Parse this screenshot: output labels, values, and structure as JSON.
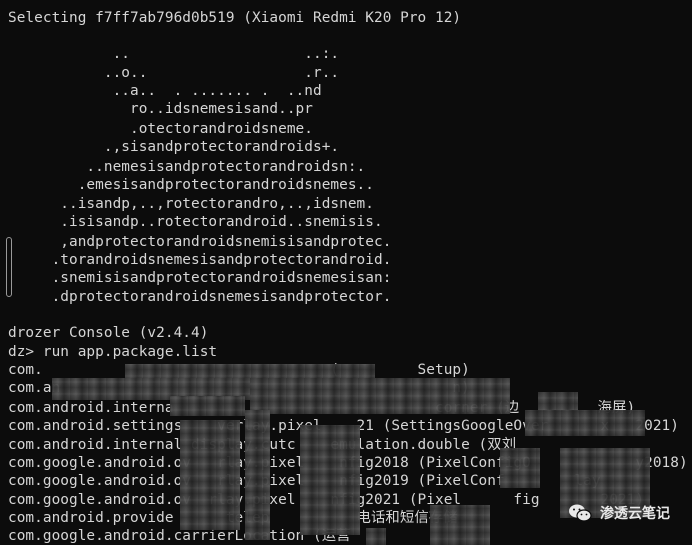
{
  "terminal": {
    "lines": [
      "Selecting f7ff7ab796d0b519 (Xiaomi Redmi K20 Pro 12)",
      "",
      "            ..                    ..:.",
      "           ..o..                  .r..",
      "            ..a..  . ....... .  ..nd",
      "              ro..idsnemesisand..pr",
      "              .otectorandroidsneme.",
      "           .,sisandprotectorandroids+.",
      "         ..nemesisandprotectorandroidsn:.",
      "        .emesisandprotectorandroidsnemes..",
      "      ..isandp,..,rotectorandro,..,idsnem.",
      "      .isisandp..rotectorandroid..snemisis.",
      "      ,andprotectorandroidsnemisisandprotec.",
      "     .torandroidsnemesisandprotectorandroid.",
      "     .snemisisandprotectorandroidsnemesisan:",
      "     .dprotectorandroidsnemesisandprotector.",
      "",
      "drozer Console (v2.4.4)",
      "dz> run app.package.list",
      "com.                                 (         Setup)",
      "com.an                                             n)",
      "com.android.interna                              corner (边         海屏)",
      "com.android.settings    verlay.pixel    21 (SettingsGoogleOver      x   2021)",
      "com.android.internal display.cutc    emulation.double (双刘",
      "com.google.android.ov   rlay.pixel    nfig2018 (PixelConfigO            y2018)",
      "com.google.android.ov   rlay.pixel    nfig2019 (PixelConf        lay",
      "com.google.android.ov  rlay.pixel    nfig2021 (Pixel      fig       2021)",
      "com.android.provide      telep          电话和短信存储",
      "com.google.android.carrierLocation (运营"
    ]
  },
  "watermark": {
    "text": "渗透云笔记",
    "icon": "wechat-icon"
  }
}
